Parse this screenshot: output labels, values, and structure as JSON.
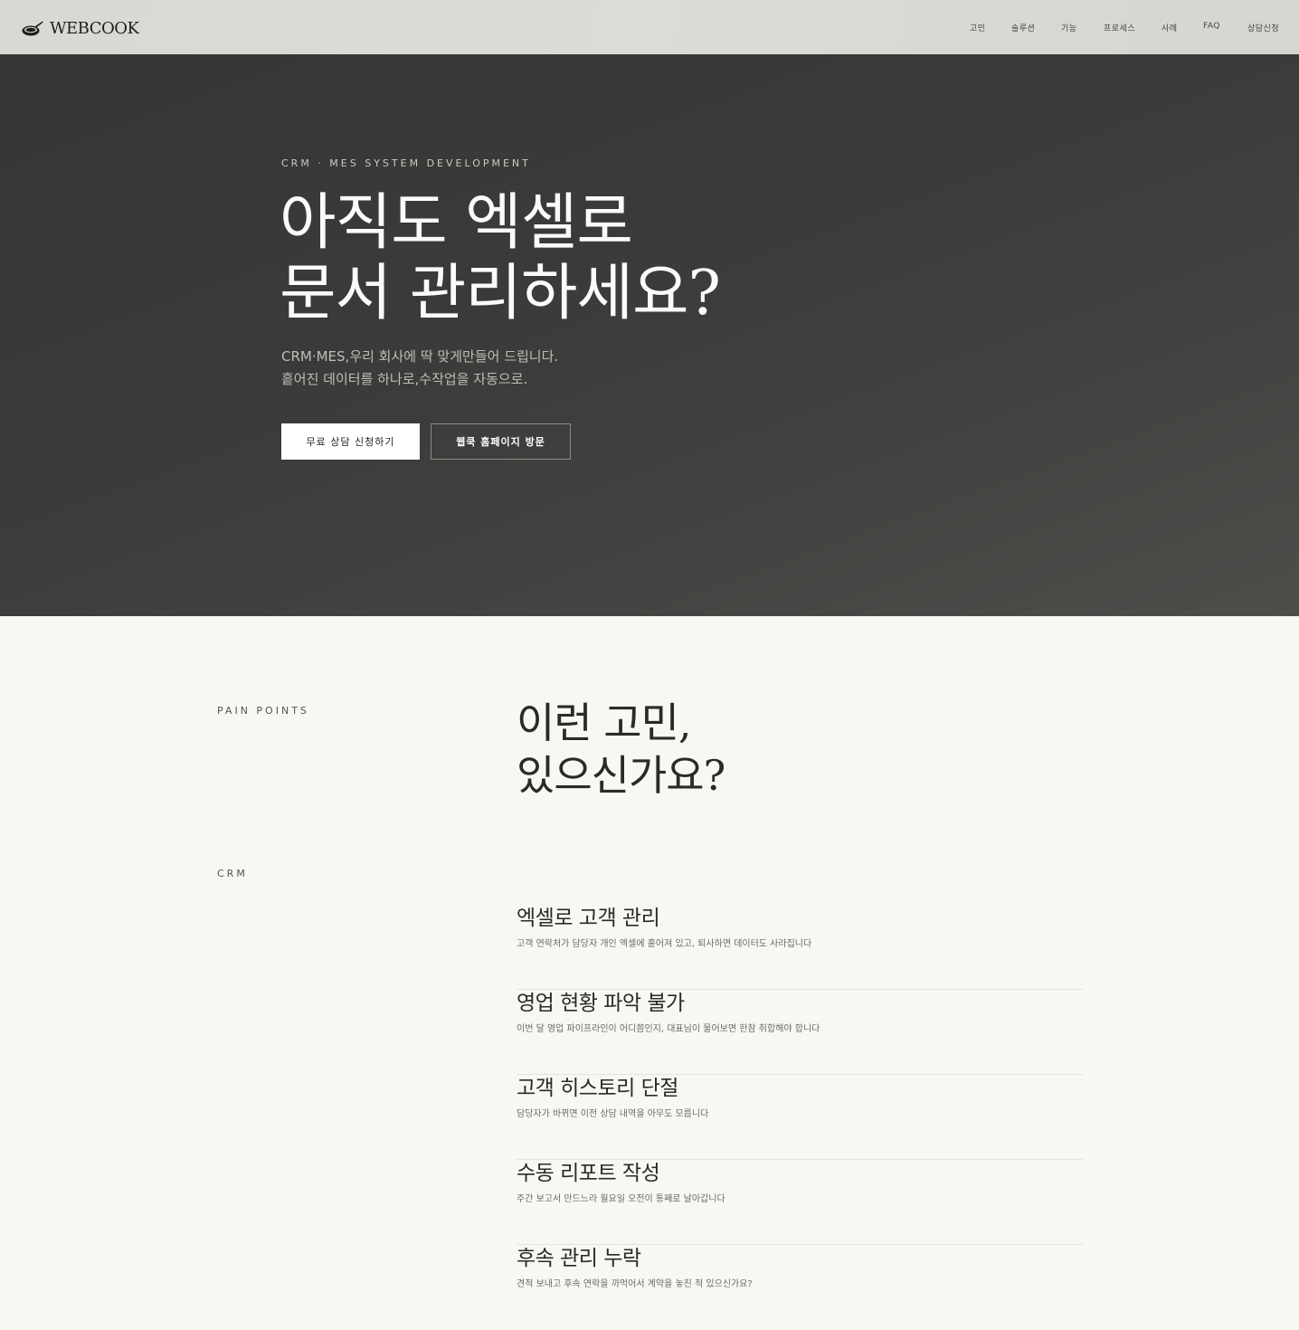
{
  "nav": {
    "logo_text": "WEBCOOK",
    "items": [
      {
        "label": "고민"
      },
      {
        "label": "솔루션"
      },
      {
        "label": "기능"
      },
      {
        "label": "프로세스"
      },
      {
        "label": "사례"
      },
      {
        "label": "FAQ"
      },
      {
        "label": "상담신청"
      }
    ]
  },
  "hero": {
    "eyebrow": "CRM · MES SYSTEM DEVELOPMENT",
    "title_line1": "아직도 엑셀로",
    "title_line2": "문서 관리하세요?",
    "sub_line1": "CRM·MES,우리 회사에 딱 맞게만들어 드립니다.",
    "sub_line2": "흩어진 데이터를 하나로,수작업을 자동으로.",
    "primary_button": "무료 상담 신청하기",
    "secondary_button": "웹쿡 홈페이지 방문"
  },
  "pain_points": {
    "label": "PAIN POINTS",
    "title_line1": "이런 고민,",
    "title_line2": "있으신가요?",
    "category": "CRM",
    "items": [
      {
        "title": "엑셀로 고객 관리",
        "desc": "고객 연락처가 담당자 개인 엑셀에 흩어져 있고, 퇴사하면 데이터도 사라집니다"
      },
      {
        "title": "영업 현황 파악 불가",
        "desc": "이번 달 영업 파이프라인이 어디쯤인지, 대표님이 물어보면 한참 취합해야 합니다"
      },
      {
        "title": "고객 히스토리 단절",
        "desc": "담당자가 바뀌면 이전 상담 내역을 아무도 모릅니다"
      },
      {
        "title": "수동 리포트 작성",
        "desc": "주간 보고서 만드느라 월요일 오전이 통째로 날아갑니다"
      },
      {
        "title": "후속 관리 누락",
        "desc": "견적 보내고 후속 연락을 까먹어서 계약을 놓친 적 있으신가요?"
      }
    ]
  }
}
